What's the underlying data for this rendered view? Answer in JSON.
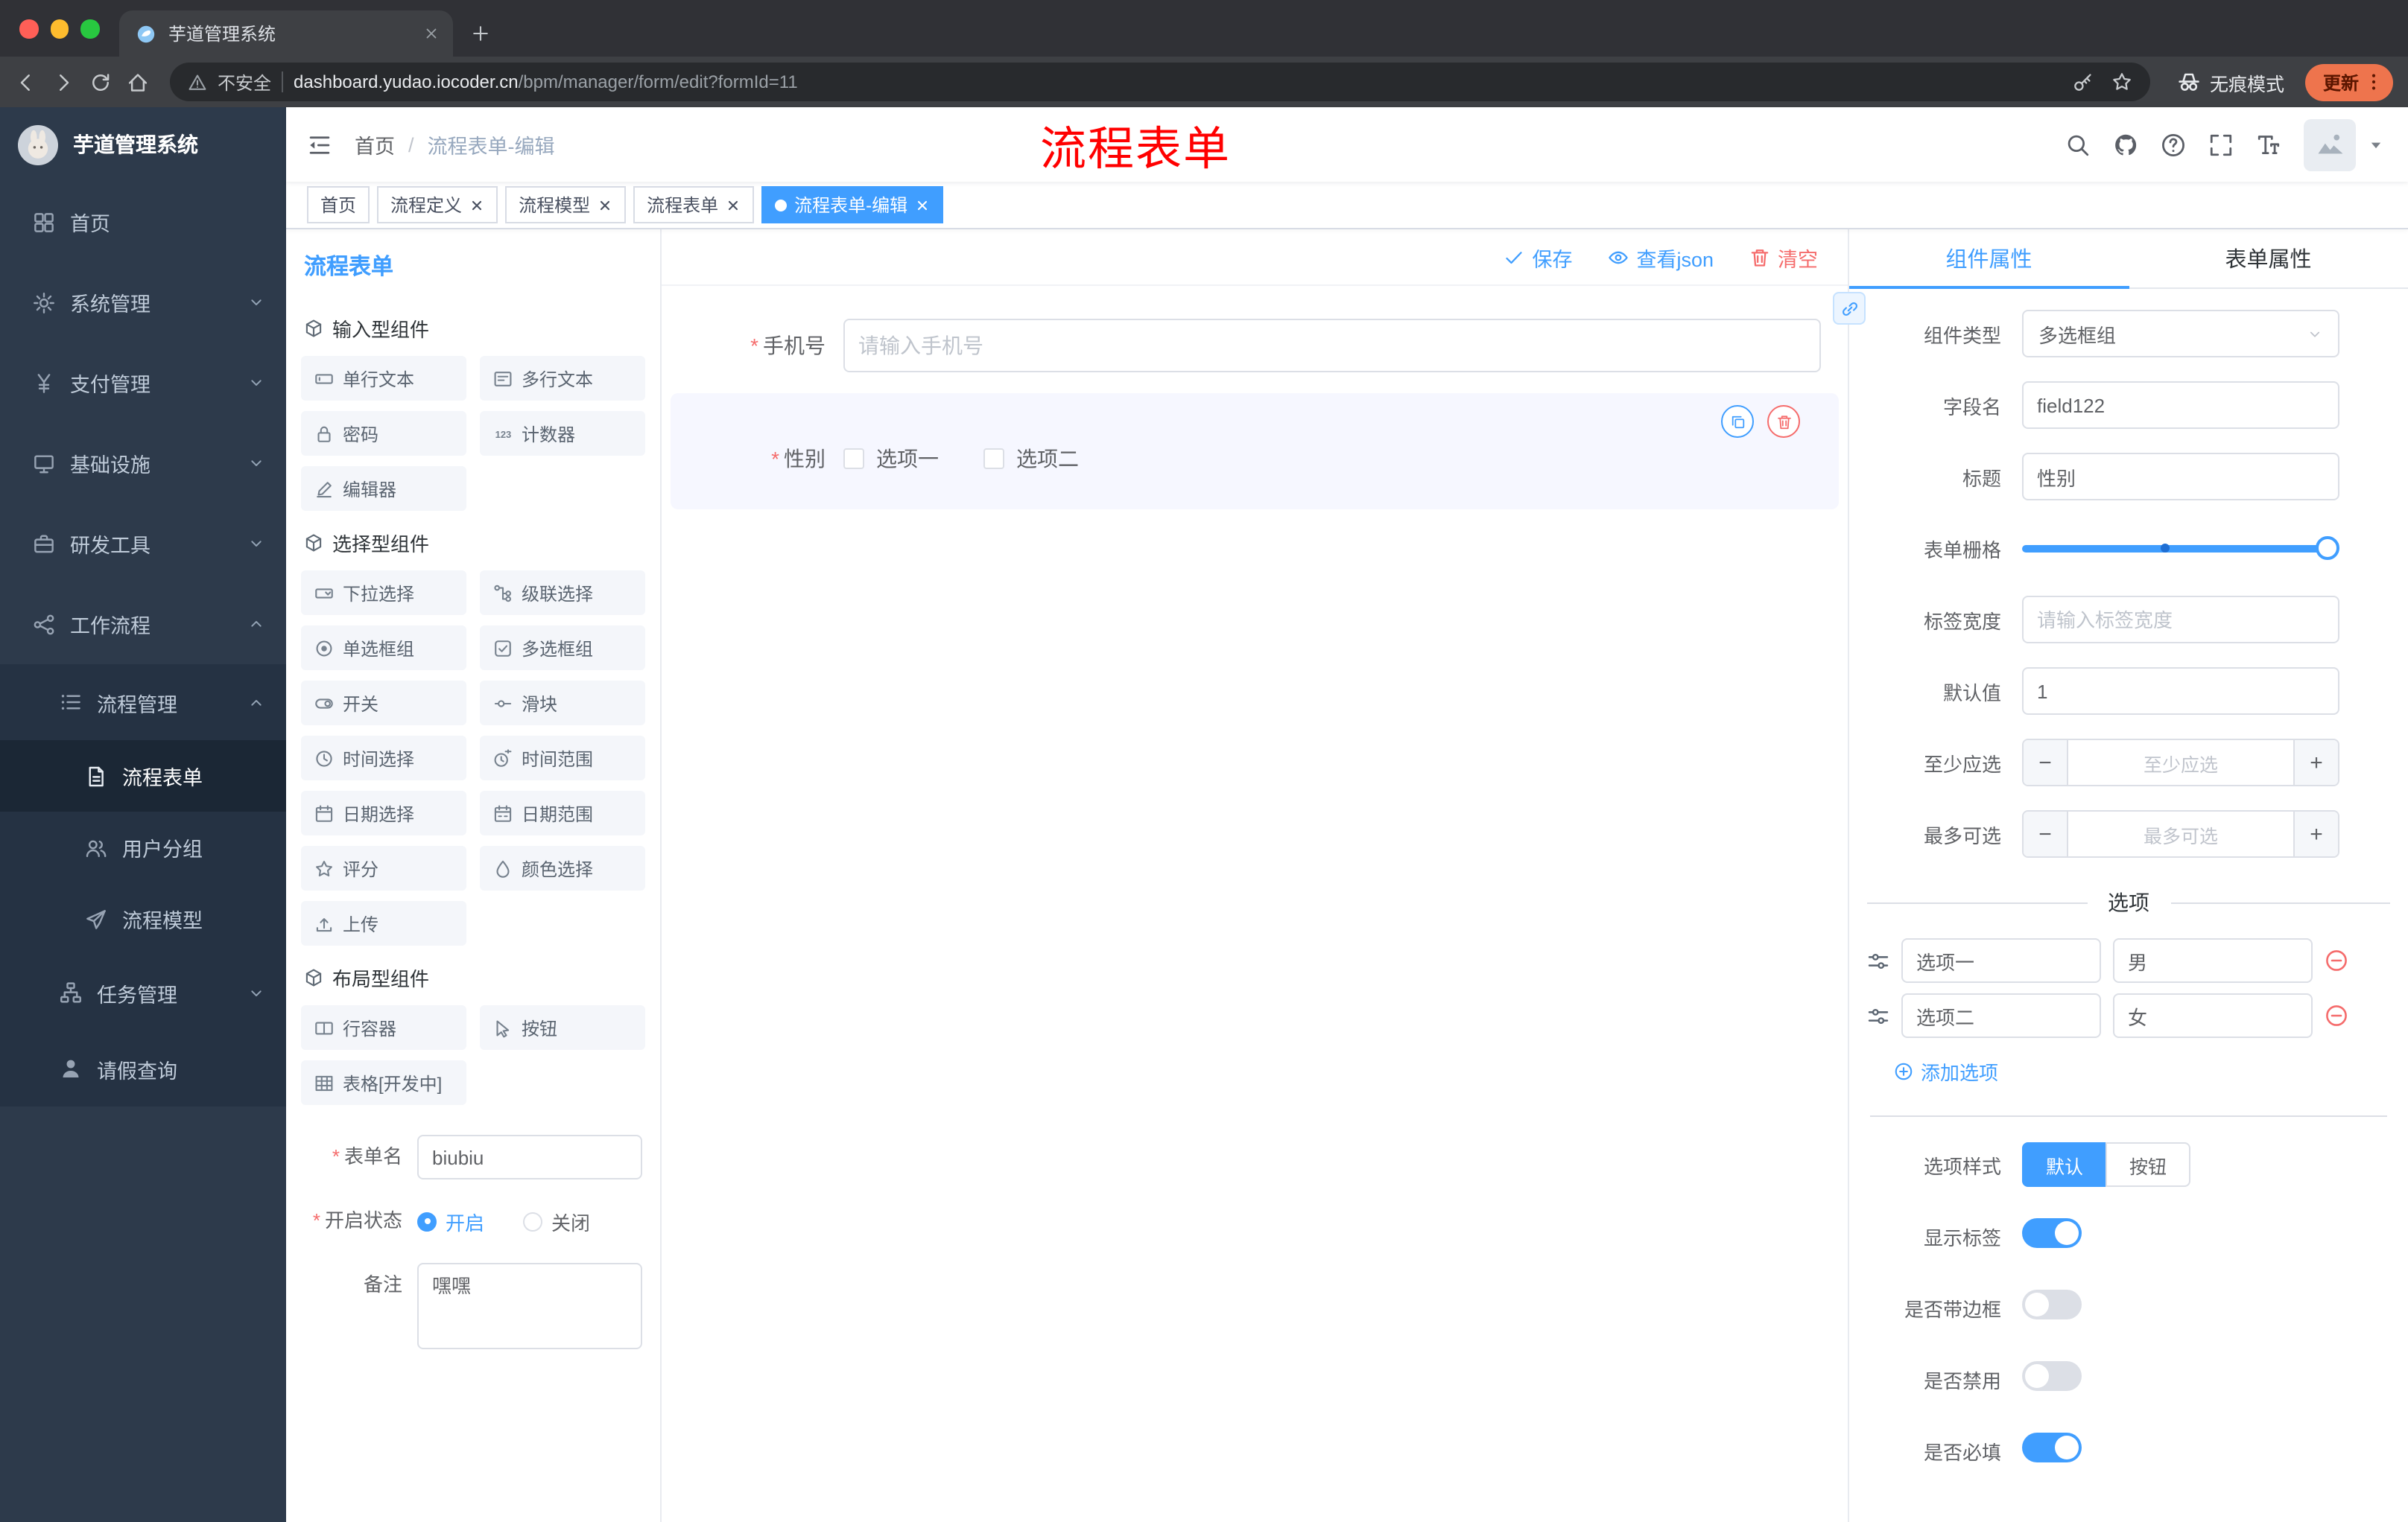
{
  "browser": {
    "tab_title": "芋道管理系统",
    "security_label": "不安全",
    "url_domain": "dashboard.yudao.iocoder.cn",
    "url_path": "/bpm/manager/form/edit?formId=11",
    "incognito_label": "无痕模式",
    "update_label": "更新"
  },
  "sidebar": {
    "logo_title": "芋道管理系统",
    "items": [
      {
        "label": "首页",
        "icon": "dashboard",
        "level": 1
      },
      {
        "label": "系统管理",
        "icon": "gear",
        "level": 1,
        "arrow": "down"
      },
      {
        "label": "支付管理",
        "icon": "yen",
        "level": 1,
        "arrow": "down"
      },
      {
        "label": "基础设施",
        "icon": "infra",
        "level": 1,
        "arrow": "down"
      },
      {
        "label": "研发工具",
        "icon": "tools",
        "level": 1,
        "arrow": "down"
      },
      {
        "label": "工作流程",
        "icon": "workflow",
        "level": 1,
        "arrow": "up"
      },
      {
        "label": "流程管理",
        "icon": "list",
        "level": 2,
        "arrow": "up"
      },
      {
        "label": "流程表单",
        "icon": "doc",
        "level": 3,
        "active": true
      },
      {
        "label": "用户分组",
        "icon": "users",
        "level": 3
      },
      {
        "label": "流程模型",
        "icon": "send",
        "level": 3
      },
      {
        "label": "任务管理",
        "icon": "task",
        "level": 2,
        "arrow": "down"
      },
      {
        "label": "请假查询",
        "icon": "person",
        "level": 2
      }
    ]
  },
  "header": {
    "breadcrumb_home": "首页",
    "breadcrumb_current": "流程表单-编辑",
    "annotation": "流程表单"
  },
  "tags": [
    {
      "label": "首页",
      "closable": false,
      "active": false
    },
    {
      "label": "流程定义",
      "closable": true,
      "active": false
    },
    {
      "label": "流程模型",
      "closable": true,
      "active": false
    },
    {
      "label": "流程表单",
      "closable": true,
      "active": false
    },
    {
      "label": "流程表单-编辑",
      "closable": true,
      "active": true
    }
  ],
  "designer": {
    "title": "流程表单",
    "sections": [
      {
        "title": "输入型组件",
        "items": [
          {
            "label": "单行文本",
            "icon": "input"
          },
          {
            "label": "多行文本",
            "icon": "textarea"
          },
          {
            "label": "密码",
            "icon": "lock"
          },
          {
            "label": "计数器",
            "icon": "counter"
          },
          {
            "label": "编辑器",
            "icon": "editor"
          }
        ]
      },
      {
        "title": "选择型组件",
        "items": [
          {
            "label": "下拉选择",
            "icon": "select"
          },
          {
            "label": "级联选择",
            "icon": "cascade"
          },
          {
            "label": "单选框组",
            "icon": "radio"
          },
          {
            "label": "多选框组",
            "icon": "checkbox"
          },
          {
            "label": "开关",
            "icon": "switch"
          },
          {
            "label": "滑块",
            "icon": "slider"
          },
          {
            "label": "时间选择",
            "icon": "time"
          },
          {
            "label": "时间范围",
            "icon": "time-range"
          },
          {
            "label": "日期选择",
            "icon": "date"
          },
          {
            "label": "日期范围",
            "icon": "date-range"
          },
          {
            "label": "评分",
            "icon": "rate"
          },
          {
            "label": "颜色选择",
            "icon": "color"
          },
          {
            "label": "上传",
            "icon": "upload"
          }
        ]
      },
      {
        "title": "布局型组件",
        "items": [
          {
            "label": "行容器",
            "icon": "row"
          },
          {
            "label": "按钮",
            "icon": "btn"
          },
          {
            "label": "表格[开发中]",
            "icon": "table"
          }
        ]
      }
    ],
    "form": {
      "name_label": "表单名",
      "name_value": "biubiu",
      "status_label": "开启状态",
      "status_on": "开启",
      "status_off": "关闭",
      "remark_label": "备注",
      "remark_value": "嘿嘿"
    }
  },
  "canvas": {
    "actions": [
      {
        "label": "保存",
        "icon": "check",
        "danger": false
      },
      {
        "label": "查看json",
        "icon": "eye",
        "danger": false
      },
      {
        "label": "清空",
        "icon": "trash",
        "danger": true
      }
    ],
    "phone": {
      "label": "手机号",
      "placeholder": "请输入手机号"
    },
    "gender": {
      "label": "性别",
      "option1": "选项一",
      "option2": "选项二"
    }
  },
  "properties": {
    "tab_component": "组件属性",
    "tab_form": "表单属性",
    "component_type": {
      "label": "组件类型",
      "value": "多选框组"
    },
    "field_name": {
      "label": "字段名",
      "value": "field122"
    },
    "title": {
      "label": "标题",
      "value": "性别"
    },
    "grid": {
      "label": "表单栅格"
    },
    "label_width": {
      "label": "标签宽度",
      "placeholder": "请输入标签宽度"
    },
    "default_value": {
      "label": "默认值",
      "value": "1"
    },
    "min_select": {
      "label": "至少应选",
      "placeholder": "至少应选"
    },
    "max_select": {
      "label": "最多可选",
      "placeholder": "最多可选"
    },
    "options_title": "选项",
    "options": [
      {
        "name": "选项一",
        "value": "男"
      },
      {
        "name": "选项二",
        "value": "女"
      }
    ],
    "add_option": "添加选项",
    "option_style": {
      "label": "选项样式",
      "default": "默认",
      "button": "按钮"
    },
    "switches": [
      {
        "label": "显示标签",
        "on": true
      },
      {
        "label": "是否带边框",
        "on": false
      },
      {
        "label": "是否禁用",
        "on": false
      },
      {
        "label": "是否必填",
        "on": true
      }
    ]
  },
  "colors": {
    "accent": "#409eff",
    "danger": "#f56c6c",
    "annotation": "#ff0000"
  }
}
